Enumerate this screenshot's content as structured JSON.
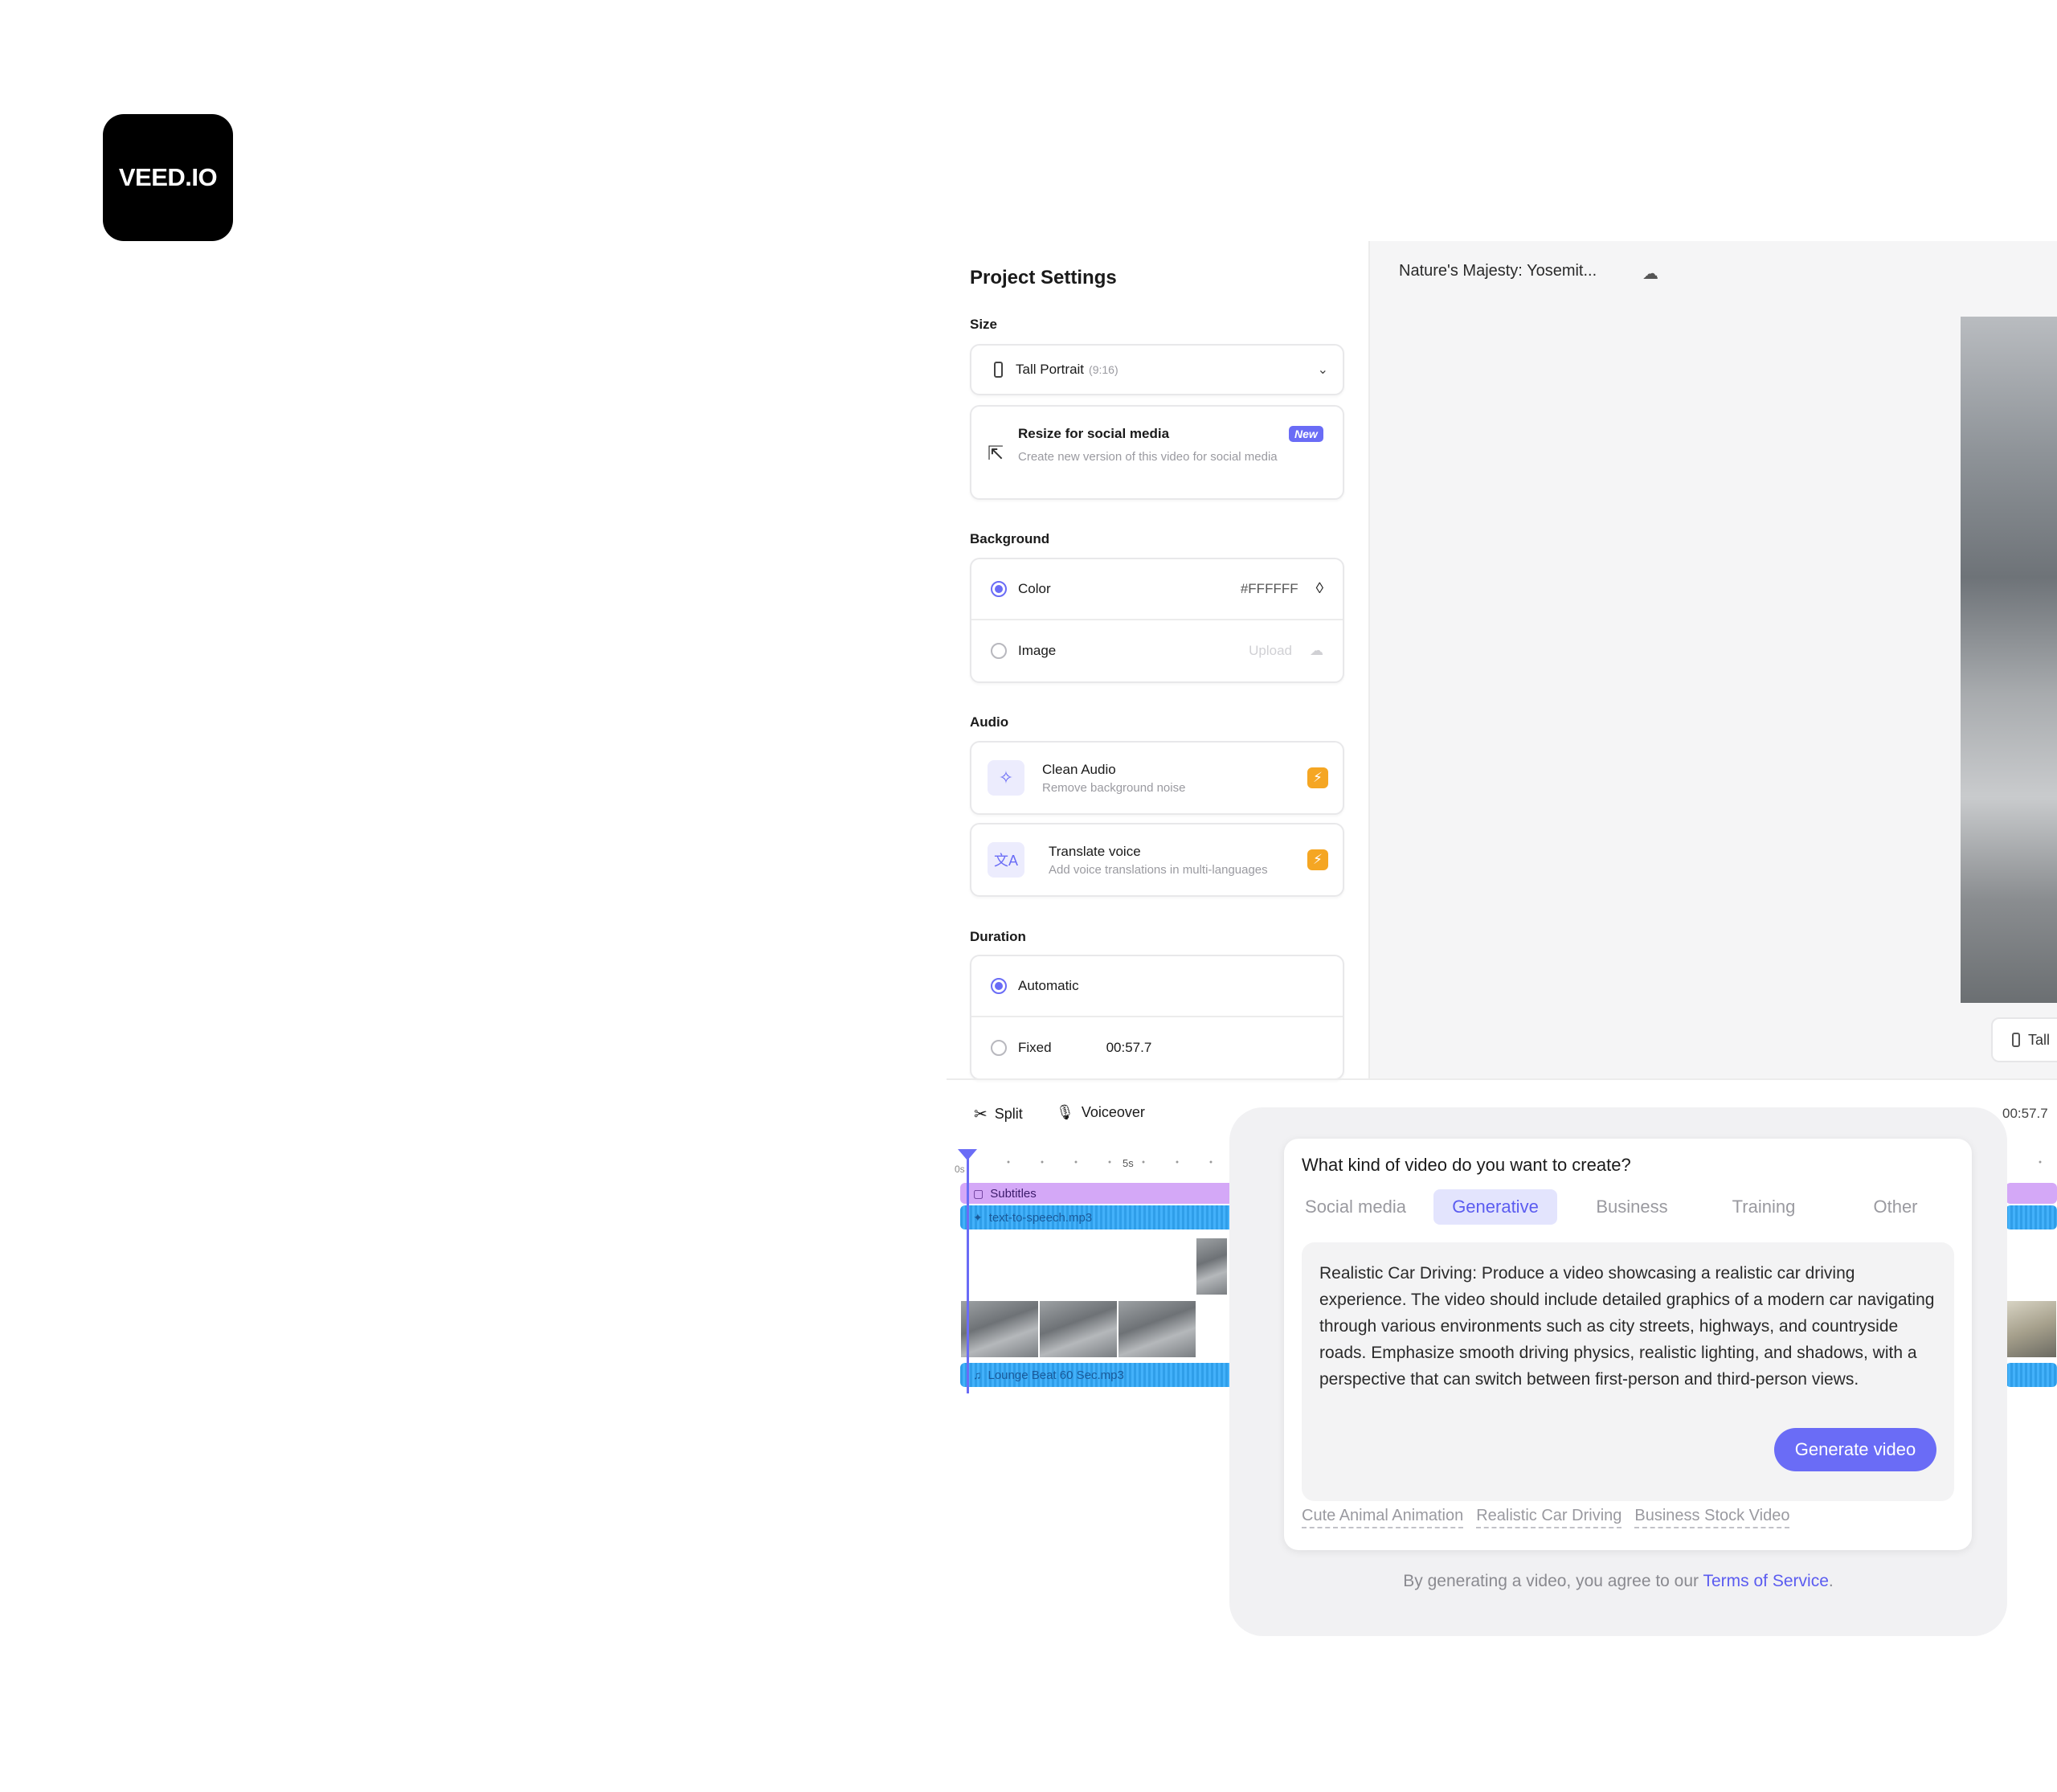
{
  "brand": {
    "logo_text": "VEED.IO"
  },
  "project_settings": {
    "title": "Project Settings",
    "size": {
      "label": "Size",
      "selected": "Tall Portrait",
      "ratio": "(9:16)"
    },
    "resize": {
      "title": "Resize for social media",
      "badge": "New",
      "description": "Create new version of this video for social media"
    },
    "background": {
      "label": "Background",
      "color_option": "Color",
      "color_value": "#FFFFFF",
      "image_option": "Image",
      "upload_label": "Upload",
      "selected": "Color"
    },
    "audio": {
      "label": "Audio",
      "items": [
        {
          "title": "Clean Audio",
          "description": "Remove background noise"
        },
        {
          "title": "Translate voice",
          "description": "Add voice translations in multi-languages"
        }
      ]
    },
    "duration": {
      "label": "Duration",
      "automatic": "Automatic",
      "fixed": "Fixed",
      "fixed_value": "00:57.7",
      "selected": "Automatic"
    }
  },
  "canvas": {
    "project_name": "Nature's Majesty: Yosemit...",
    "size_chip": "Tall"
  },
  "timeline": {
    "tools": {
      "split": "Split",
      "voiceover": "Voiceover"
    },
    "time_total": "00:57.7",
    "ruler": {
      "start": "0s",
      "mark": "5s"
    },
    "tracks": {
      "subtitles": "Subtitles",
      "tts": "text-to-speech.mp3",
      "music": "Lounge Beat 60 Sec.mp3"
    }
  },
  "generate_modal": {
    "question": "What kind of video do you want to create?",
    "tabs": [
      "Social media",
      "Generative",
      "Business",
      "Training",
      "Other"
    ],
    "active_tab": "Generative",
    "prompt": "Realistic Car Driving: Produce a video showcasing a realistic car driving experience. The video should include detailed graphics of a modern car navigating through various environments such as city streets, highways, and countryside roads. Emphasize smooth driving physics, realistic lighting, and shadows, with a perspective that can switch between first-person and third-person views.",
    "generate_button": "Generate video",
    "suggestions": [
      "Cute Animal Animation",
      "Realistic Car Driving",
      "Business Stock Video"
    ],
    "tos_prefix": "By generating a video, you agree to our",
    "tos_link": "Terms of Service",
    "tos_suffix": "."
  },
  "colors": {
    "accent": "#6a6cf6",
    "badge_orange": "#f5a623",
    "track_purple": "#d4a8f7",
    "track_blue": "#43b1fa"
  }
}
